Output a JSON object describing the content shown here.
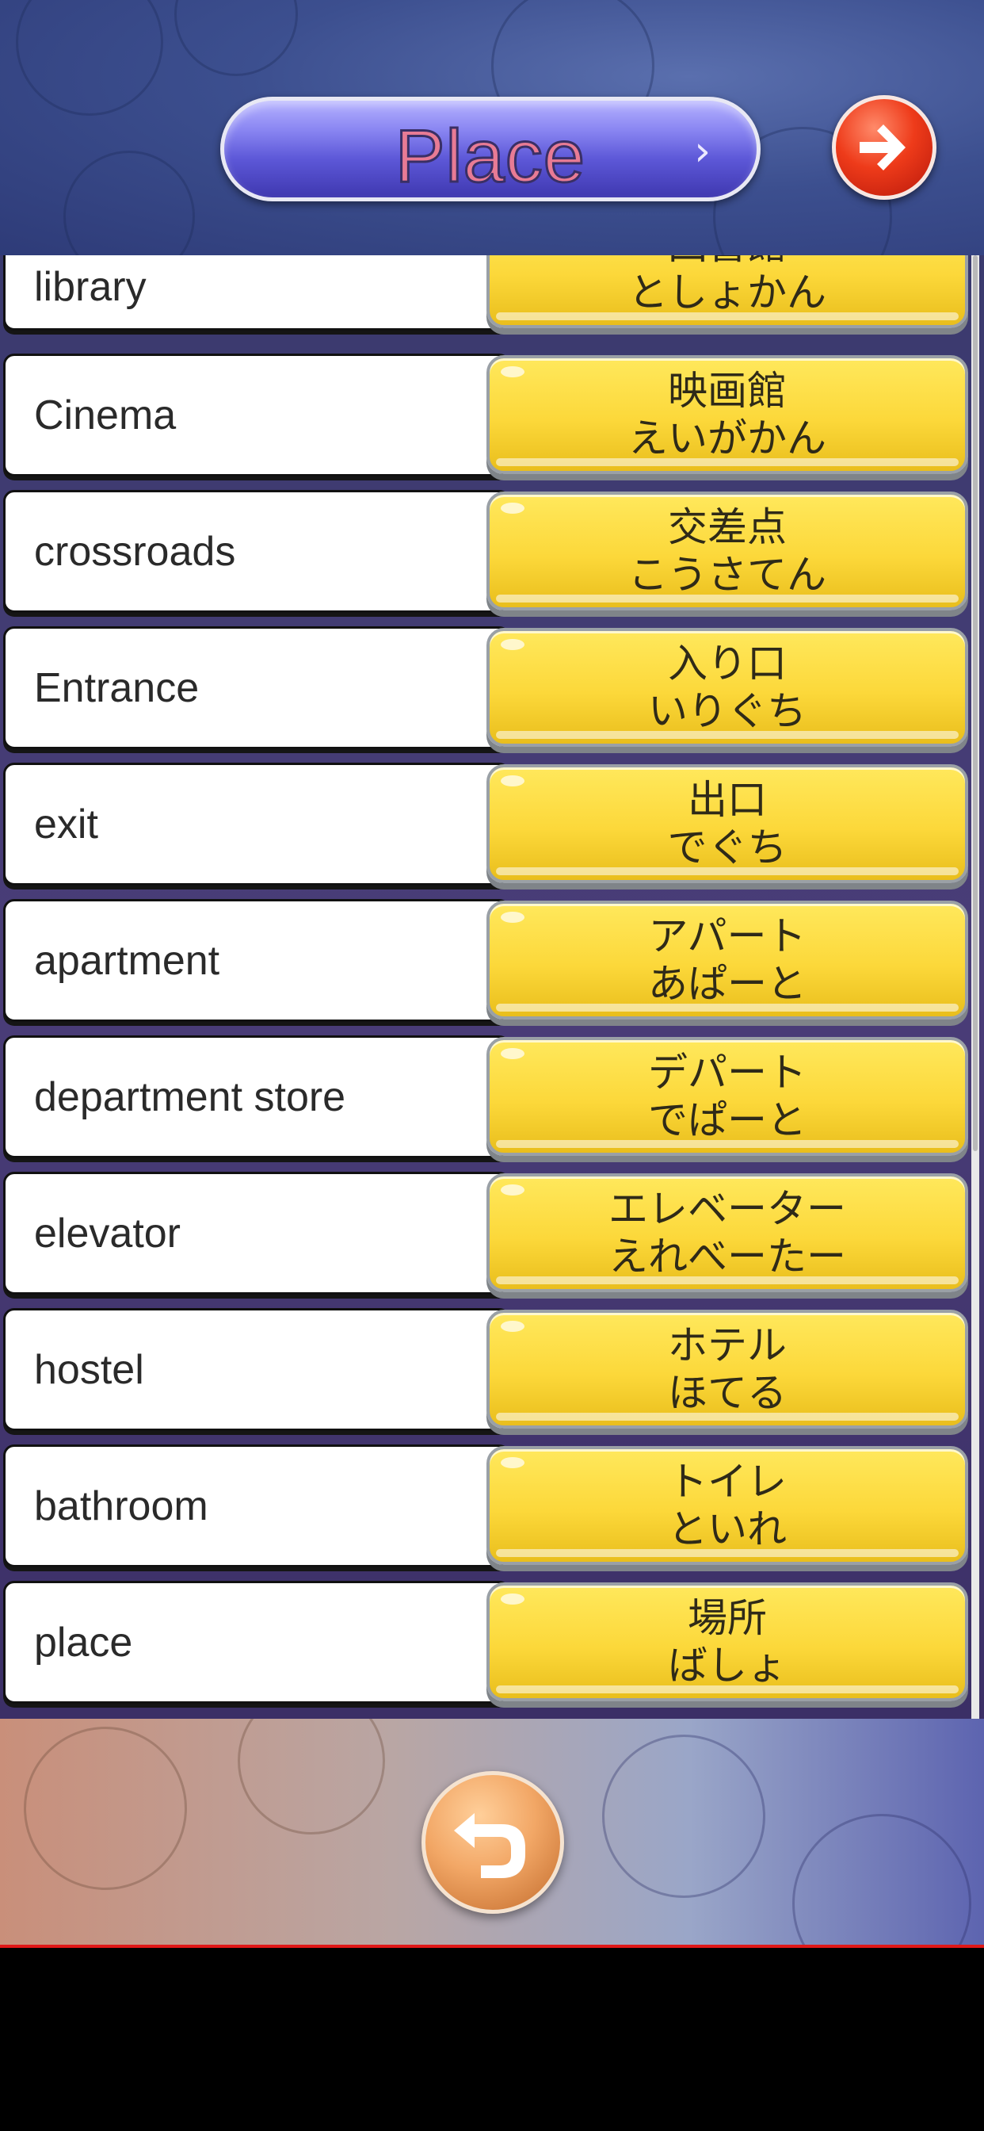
{
  "header": {
    "title": "Place",
    "title_chevron": "›",
    "next_icon": "arrow-right-icon"
  },
  "rows": [
    {
      "en": "library",
      "kanji": "図書館",
      "kana": "としょかん"
    },
    {
      "en": "Cinema",
      "kanji": "映画館",
      "kana": "えいがかん"
    },
    {
      "en": "crossroads",
      "kanji": "交差点",
      "kana": "こうさてん"
    },
    {
      "en": "Entrance",
      "kanji": "入り口",
      "kana": "いりぐち"
    },
    {
      "en": "exit",
      "kanji": "出口",
      "kana": "でぐち"
    },
    {
      "en": "apartment",
      "kanji": "アパート",
      "kana": "あぱーと"
    },
    {
      "en": "department store",
      "kanji": "デパート",
      "kana": "でぱーと"
    },
    {
      "en": "elevator",
      "kanji": "エレベーター",
      "kana": "えれべーたー"
    },
    {
      "en": "hostel",
      "kanji": "ホテル",
      "kana": "ほてる"
    },
    {
      "en": "bathroom",
      "kanji": "トイレ",
      "kana": "といれ"
    },
    {
      "en": "place",
      "kanji": "場所",
      "kana": "ばしょ"
    }
  ],
  "footer": {
    "back_icon": "undo-arrow-icon"
  },
  "colors": {
    "header_bg": "#3c4f8f",
    "title_pill": "#5d58d8",
    "title_text": "#e87b95",
    "next_button": "#ee3b1a",
    "answer_button": "#fcd83a",
    "back_button": "#f2a766"
  }
}
